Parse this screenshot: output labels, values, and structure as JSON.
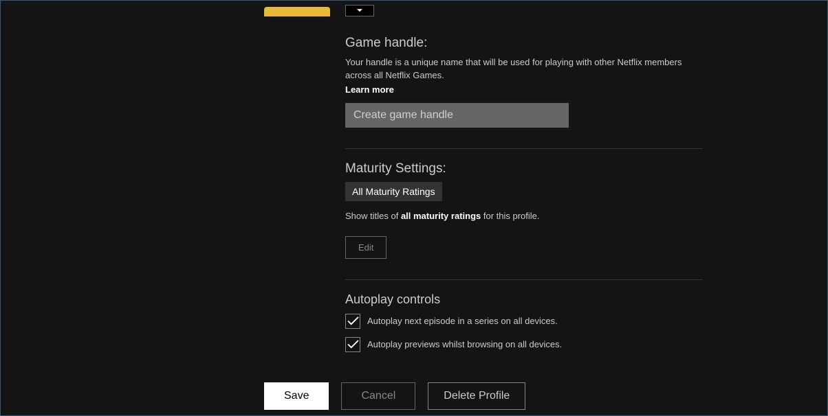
{
  "gameHandle": {
    "title": "Game handle:",
    "description": "Your handle is a unique name that will be used for playing with other Netflix members across all Netflix Games.",
    "learnMore": "Learn more",
    "placeholder": "Create game handle"
  },
  "maturity": {
    "title": "Maturity Settings:",
    "badge": "All Maturity Ratings",
    "descPrefix": "Show titles of ",
    "descBold": "all maturity ratings",
    "descSuffix": " for this profile.",
    "editLabel": "Edit"
  },
  "autoplay": {
    "title": "Autoplay controls",
    "option1": "Autoplay next episode in a series on all devices.",
    "option2": "Autoplay previews whilst browsing on all devices."
  },
  "footer": {
    "save": "Save",
    "cancel": "Cancel",
    "delete": "Delete Profile"
  }
}
